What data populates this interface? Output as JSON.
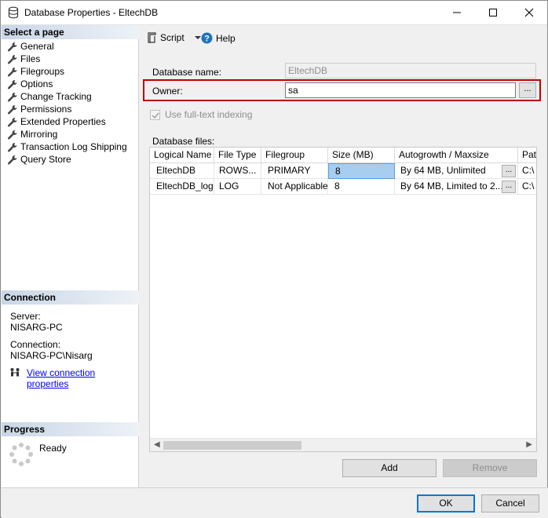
{
  "window": {
    "title": "Database Properties - EltechDB"
  },
  "left": {
    "select_page_header": "Select a page",
    "pages": [
      "General",
      "Files",
      "Filegroups",
      "Options",
      "Change Tracking",
      "Permissions",
      "Extended Properties",
      "Mirroring",
      "Transaction Log Shipping",
      "Query Store"
    ],
    "connection_header": "Connection",
    "server_label": "Server:",
    "server_value": "NISARG-PC",
    "connection_label": "Connection:",
    "connection_value": "NISARG-PC\\Nisarg",
    "view_link": "View connection properties",
    "progress_header": "Progress",
    "progress_status": "Ready"
  },
  "toolbar": {
    "script_label": "Script",
    "help_label": "Help"
  },
  "form": {
    "db_name_label": "Database name:",
    "db_name_value": "EltechDB",
    "owner_label": "Owner:",
    "owner_value": "sa",
    "owner_browse": "...",
    "fulltext_label": "Use full-text indexing",
    "db_files_label": "Database files:"
  },
  "grid": {
    "columns": [
      "Logical Name",
      "File Type",
      "Filegroup",
      "Size (MB)",
      "Autogrowth / Maxsize",
      "Path"
    ],
    "rows": [
      {
        "name": "EltechDB",
        "type": "ROWS...",
        "group": "PRIMARY",
        "size": "8",
        "growth": "By 64 MB, Unlimited",
        "btn": "...",
        "path": "C:\\"
      },
      {
        "name": "EltechDB_log",
        "type": "LOG",
        "group": "Not Applicable",
        "size": "8",
        "growth": "By 64 MB, Limited to 2...",
        "btn": "...",
        "path": "C:\\"
      }
    ]
  },
  "buttons": {
    "add": "Add",
    "remove": "Remove",
    "ok": "OK",
    "cancel": "Cancel"
  },
  "colors": {
    "highlight": "#c00000",
    "selection": "#a7cdf0",
    "link": "#0000ee",
    "accent": "#0078d7"
  }
}
